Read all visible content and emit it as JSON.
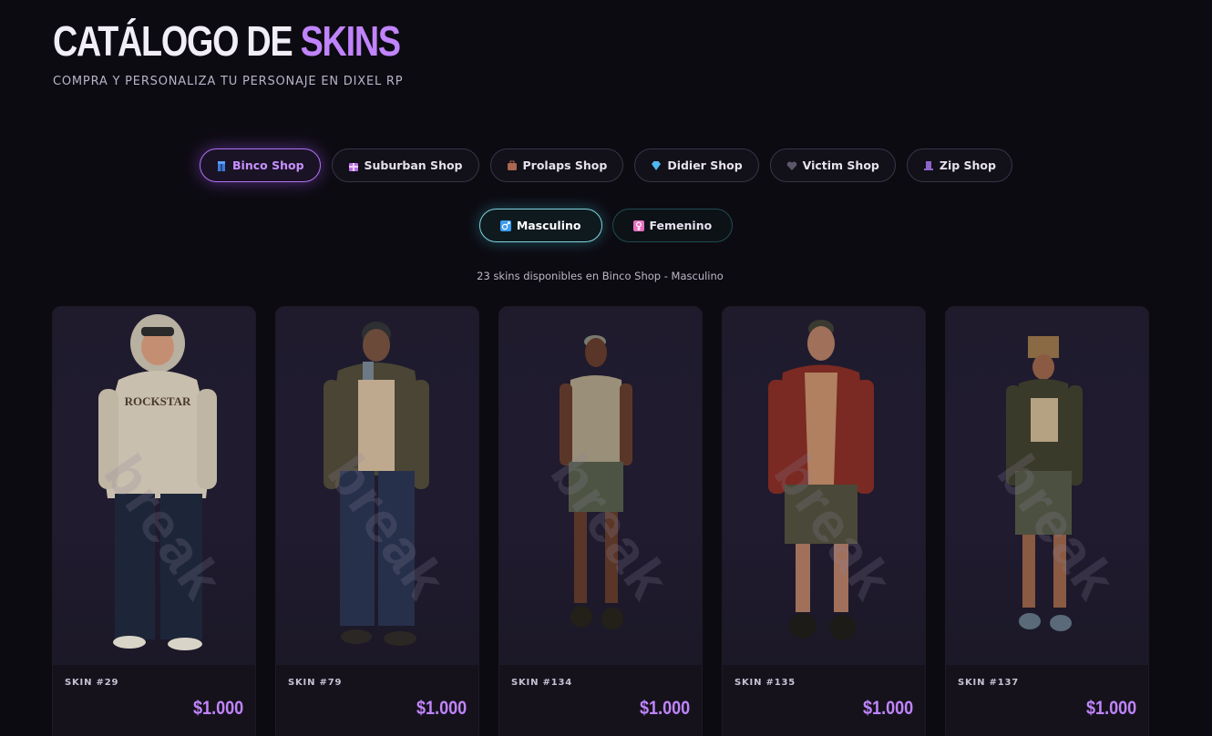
{
  "header": {
    "title_main": "CATÁLOGO DE ",
    "title_accent": "SKINS",
    "subtitle": "COMPRA Y PERSONALIZA TU PERSONAJE EN DIXEL RP"
  },
  "shops": [
    {
      "label": "Binco Shop",
      "icon": "jeans-icon",
      "icon_color": "#5aa0ff",
      "active": true
    },
    {
      "label": "Suburban Shop",
      "icon": "gift-icon",
      "icon_color": "#d08cf0",
      "active": false
    },
    {
      "label": "Prolaps Shop",
      "icon": "briefcase-icon",
      "icon_color": "#b0705a",
      "active": false
    },
    {
      "label": "Didier Shop",
      "icon": "diamond-icon",
      "icon_color": "#5ec8f5",
      "active": false
    },
    {
      "label": "Victim Shop",
      "icon": "heart-icon",
      "icon_color": "#6e6780",
      "active": false
    },
    {
      "label": "Zip Shop",
      "icon": "hat-icon",
      "icon_color": "#9a6fd0",
      "active": false
    }
  ],
  "genders": [
    {
      "label": "Masculino",
      "icon": "male-icon",
      "icon_color": "#3c9cf0",
      "active": true
    },
    {
      "label": "Femenino",
      "icon": "female-icon",
      "icon_color": "#e86fc0",
      "active": false
    }
  ],
  "count_text": "23 skins disponibles en Binco Shop - Masculino",
  "skins": [
    {
      "label": "SKIN #29",
      "price": "$1.000"
    },
    {
      "label": "SKIN #79",
      "price": "$1.000"
    },
    {
      "label": "SKIN #134",
      "price": "$1.000"
    },
    {
      "label": "SKIN #135",
      "price": "$1.000"
    },
    {
      "label": "SKIN #137",
      "price": "$1.000"
    }
  ],
  "watermark": "break",
  "colors": {
    "accent": "#c084fc",
    "background": "#0d0b12",
    "card": "#15121c"
  }
}
